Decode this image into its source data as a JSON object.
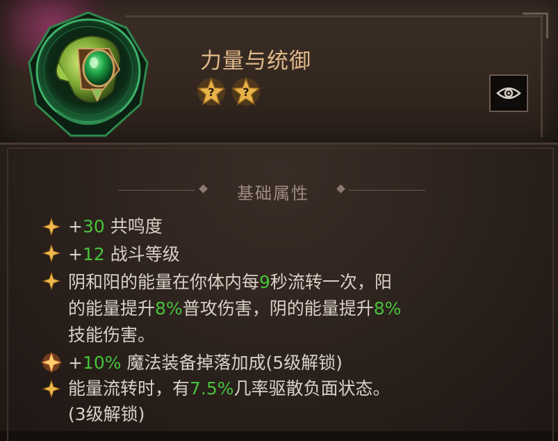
{
  "item": {
    "title": "力量与统御",
    "star_glyph": "?",
    "star_count": 2,
    "icon_name": "green-tiara-gem-icon"
  },
  "inspect_button": {
    "icon": "eye-icon"
  },
  "section": {
    "title": "基础属性"
  },
  "colors": {
    "title": "#e0b98a",
    "highlight": "#46c33a",
    "text": "#d9d1c8",
    "section": "#9d8d83"
  },
  "attributes": [
    {
      "prefix": "+",
      "value": "30",
      "text": " 共鸣度"
    },
    {
      "prefix": "+",
      "value": "12",
      "text": " 战斗等级"
    },
    {
      "line1_a": "阴和阳的能量在你体内每",
      "line1_b": "9",
      "line1_c": "秒流转一次，阳",
      "line2_a": "的能量提升",
      "line2_b": "8%",
      "line2_c": "普攻伤害，阴的能量提升",
      "line2_d": "8%",
      "line3": "技能伤害。"
    },
    {
      "prefix": "+",
      "value": "10%",
      "text": " 魔法装备掉落加成(5级解锁)"
    },
    {
      "line1_a": "能量流转时，有",
      "line1_b": "7.5%",
      "line1_c": "几率驱散负面状态。",
      "line2": "(3级解锁)"
    }
  ]
}
